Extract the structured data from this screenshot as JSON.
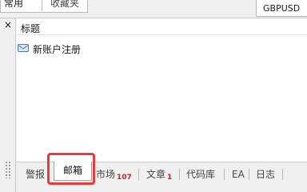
{
  "top_tabs": {
    "common": "常用",
    "favorites": "收藏夹"
  },
  "symbol_tab": "GBPUSD",
  "panel": {
    "close_glyph": "×",
    "column_header": "标题",
    "rows": [
      {
        "title": "新账户注册",
        "icon": "mail-icon"
      }
    ]
  },
  "bottom_tabs": {
    "alerts": "警报",
    "mailbox": "邮箱",
    "market": "市场",
    "market_count": "107",
    "articles": "文章",
    "articles_count": "1",
    "code_base": "代码库",
    "ea": "EA",
    "journal": "日志"
  },
  "colors": {
    "highlight": "#e53b3b",
    "count_badge": "#c0262a"
  }
}
